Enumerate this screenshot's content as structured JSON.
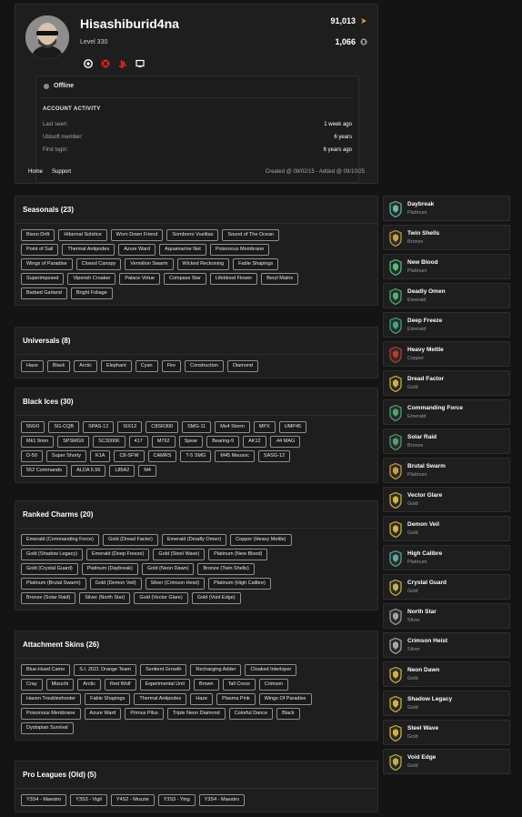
{
  "profile": {
    "username": "Hisashiburid4na",
    "level": "Level 330",
    "stats": [
      {
        "value": "91,013",
        "icon": "renown-icon",
        "color": "#e8b923"
      },
      {
        "value": "1,066",
        "icon": "r6-credits-icon",
        "color": "#9a9a9a"
      }
    ],
    "platforms": [
      "ubisoft-icon",
      "xbox-icon",
      "playstation-icon",
      "pc-icon"
    ],
    "status": "Offline",
    "activity_title": "ACCOUNT ACTIVITY",
    "activity": [
      {
        "label": "Last seen:",
        "value": "1 week ago"
      },
      {
        "label": "Ubisoft member:",
        "value": "6 years"
      },
      {
        "label": "First login:",
        "value": "6 years ago"
      }
    ],
    "nav": [
      "Home",
      "Support"
    ],
    "created": "Created @ 08/02/15 - Added @ 09/10/25"
  },
  "sections": [
    {
      "title": "Seasonals (23)",
      "rows": [
        [
          "Bison Drift",
          "Hibernal Solstice",
          "Worn Down Friend",
          "Sombrero Vuelitas",
          "Sound of The Ocean"
        ],
        [
          "Point of Sail",
          "Thermal Antipodes",
          "Azure Ward",
          "Aquamarine Net",
          "Poisonous Membrane"
        ],
        [
          "Wings of Paradise",
          "Closed Canopy",
          "Vermilion Swarm",
          "Wicked Reckoning",
          "Fable Shapings"
        ],
        [
          "Superimposed",
          "Viperish Croaker",
          "Palace Virtue",
          "Compass Star",
          "Lifeblood Flower",
          "Beryl Matrix"
        ],
        [
          "Barbed Garland",
          "Bright Foliage"
        ]
      ]
    },
    {
      "title": "Universals (8)",
      "rows": [
        [
          "Haze",
          "Black",
          "Arctic",
          "Elephant",
          "Cyan",
          "Fire",
          "Construction",
          "Diamond"
        ]
      ]
    },
    {
      "title": "Black Ices (30)",
      "rows": [
        [
          "556XI",
          "SG-CQB",
          "SPAS-12",
          "SIX12",
          "C8SR300",
          "SMG-11",
          "Mx4 Storm",
          "MPX",
          "UMP45"
        ],
        [
          "Mk1 9mm",
          "SPSMG9",
          "SC3000K",
          "417",
          "M762",
          "Spear",
          "Bearing-9",
          "AK12",
          ".44 MAG"
        ],
        [
          "D-50",
          "Super Shorty",
          "K1A",
          "C8-SFW",
          "CAMRS",
          "T-5 SMG",
          "M45 Meusoc",
          "SASG-12"
        ],
        [
          "552 Commando",
          "ALDA 5.56",
          "L85A2",
          "M4"
        ]
      ]
    },
    {
      "title": "Ranked Charms (20)",
      "rows": [
        [
          "Emerald (Commanding Force)",
          "Gold (Dread Factor)",
          "Emerald (Deadly Omen)",
          "Copper (Heavy Mettle)"
        ],
        [
          "Gold (Shadow Legacy)",
          "Emerald (Deep Freeze)",
          "Gold (Steel Wave)",
          "Platinum (New Blood)"
        ],
        [
          "Gold (Crystal Guard)",
          "Platinum (Daybreak)",
          "Gold (Neon Dawn)",
          "Bronze (Twin Shells)"
        ],
        [
          "Platinum (Brutal Swarm)",
          "Gold (Demon Veil)",
          "Silver (Crimson Heist)",
          "Platinum (High Calibre)"
        ],
        [
          "Bronze (Solar Raid)",
          "Silver (North Star)",
          "Gold (Vector Glare)",
          "Gold (Void Edge)"
        ]
      ]
    },
    {
      "title": "Attachment Skins (26)",
      "rows": [
        [
          "Blue-Hued Camo",
          "S.I. 2021 Orange Team",
          "Sentient Growth",
          "Recharging Adder",
          "Cloaked Interloper"
        ],
        [
          "Cray",
          "Mizuchi",
          "Arctic",
          "Red Wolf",
          "Experimental Unit",
          "Brown",
          "Tall Cress",
          "Crimson"
        ],
        [
          "Haven Troubleshooter",
          "Fable Shapings",
          "Thermal Antipodes",
          "Haze",
          "Plasma Pink",
          "Wings Of Paradise"
        ],
        [
          "Poisonous Membrane",
          "Azure Ward",
          "Primus Pilus",
          "Triple Neon Diamond",
          "Colorful Dance",
          "Black"
        ],
        [
          "Dystopian Survival"
        ]
      ]
    },
    {
      "title": "Pro Leagues (Old) (5)",
      "rows": [
        [
          "Y3S4 - Maestro",
          "Y3S3 - Vigil",
          "Y4S2 - Mozzie",
          "Y3S3 - Ying",
          "Y3S4 - Maestro"
        ]
      ]
    }
  ],
  "charms": [
    {
      "name": "Daybreak",
      "rank": "Platinum",
      "color": "#5fb8a8"
    },
    {
      "name": "Twin Shells",
      "rank": "Bronze",
      "color": "#c8a33a"
    },
    {
      "name": "New Blood",
      "rank": "Platinum",
      "color": "#4fc07a"
    },
    {
      "name": "Deadly Omen",
      "rank": "Emerald",
      "color": "#49b374"
    },
    {
      "name": "Deep Freeze",
      "rank": "Emerald",
      "color": "#3fa87c"
    },
    {
      "name": "Heavy Mettle",
      "rank": "Copper",
      "color": "#c0392b"
    },
    {
      "name": "Dread Factor",
      "rank": "Gold",
      "color": "#d4b13a"
    },
    {
      "name": "Commanding Force",
      "rank": "Emerald",
      "color": "#4aa86e"
    },
    {
      "name": "Solar Raid",
      "rank": "Bronze",
      "color": "#4fa06a"
    },
    {
      "name": "Brutal Swarm",
      "rank": "Platinum",
      "color": "#c9a235"
    },
    {
      "name": "Vector Glare",
      "rank": "Gold",
      "color": "#d1b43c"
    },
    {
      "name": "Demon Veil",
      "rank": "Gold",
      "color": "#d4b13a"
    },
    {
      "name": "High Calibre",
      "rank": "Platinum",
      "color": "#5aa8a0"
    },
    {
      "name": "Crystal Guard",
      "rank": "Gold",
      "color": "#c9b042"
    },
    {
      "name": "North Star",
      "rank": "Silver",
      "color": "#a0a0a0"
    },
    {
      "name": "Crimson Heist",
      "rank": "Silver",
      "color": "#a8a8a8"
    },
    {
      "name": "Neon Dawn",
      "rank": "Gold",
      "color": "#d0b03b"
    },
    {
      "name": "Shadow Legacy",
      "rank": "Gold",
      "color": "#d4b13a"
    },
    {
      "name": "Steel Wave",
      "rank": "Gold",
      "color": "#d4b13a"
    },
    {
      "name": "Void Edge",
      "rank": "Gold",
      "color": "#c4b042"
    }
  ]
}
